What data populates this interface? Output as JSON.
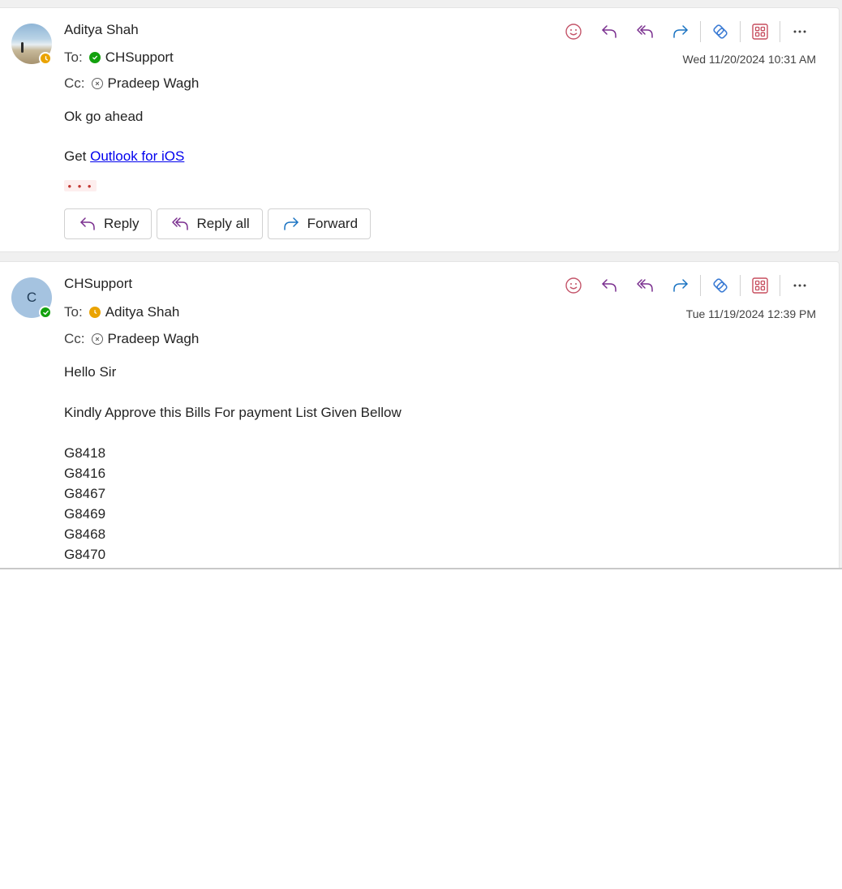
{
  "messages": [
    {
      "sender": "Aditya Shah",
      "to_label": "To:",
      "to_name": "CHSupport",
      "cc_label": "Cc:",
      "cc_name": "Pradeep Wagh",
      "timestamp": "Wed 11/20/2024 10:31 AM",
      "body_line1": "Ok go ahead",
      "get_prefix": "Get ",
      "get_link": "Outlook for iOS",
      "show_more": "• • •",
      "reply_label": "Reply",
      "reply_all_label": "Reply all",
      "forward_label": "Forward"
    },
    {
      "sender": "CHSupport",
      "avatar_initial": "C",
      "to_label": "To:",
      "to_name": "Aditya Shah",
      "cc_label": "Cc:",
      "cc_name": "Pradeep Wagh",
      "timestamp": "Tue 11/19/2024 12:39 PM",
      "greeting": "Hello Sir",
      "request": "Kindly Approve this Bills For payment List Given Bellow",
      "bills": [
        "G8418",
        "G8416",
        "G8467",
        "G8469",
        "G8468",
        "G8470"
      ]
    }
  ],
  "colors": {
    "react_icon": "#c4556a",
    "reply_icon": "#7a2f8f",
    "forward_icon": "#1a73c2",
    "loop_icon": "#3b7bd4",
    "apps_icon": "#c74e5f",
    "presence_available": "#13a10e",
    "presence_away": "#eaa300"
  },
  "icons": [
    "smiley-icon",
    "reply-icon",
    "reply-all-icon",
    "forward-icon",
    "loop-icon",
    "apps-icon",
    "more-icon"
  ]
}
